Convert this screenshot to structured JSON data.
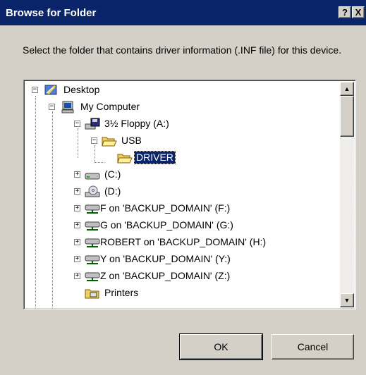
{
  "window": {
    "title": "Browse for Folder",
    "help_label": "?",
    "close_label": "X",
    "titlebar_color": "#0a246a"
  },
  "instruction": "Select the folder that contains driver information (.INF file) for this device.",
  "tree": {
    "items": [
      {
        "label": "Desktop",
        "icon": "desktop-icon",
        "expander": "−"
      },
      {
        "label": "My Computer",
        "icon": "computer-icon",
        "expander": "−"
      },
      {
        "label": "3½ Floppy (A:)",
        "icon": "floppy-drive-icon",
        "expander": "−"
      },
      {
        "label": "USB",
        "icon": "open-folder-icon",
        "expander": "−"
      },
      {
        "label": "DRIVER",
        "icon": "open-folder-icon",
        "expander": "",
        "selected": true
      },
      {
        "label": "(C:)",
        "icon": "hard-drive-icon",
        "expander": "+"
      },
      {
        "label": "(D:)",
        "icon": "cd-drive-icon",
        "expander": "+"
      },
      {
        "label": "F on 'BACKUP_DOMAIN' (F:)",
        "icon": "network-drive-icon",
        "expander": "+"
      },
      {
        "label": "G on 'BACKUP_DOMAIN' (G:)",
        "icon": "network-drive-icon",
        "expander": "+"
      },
      {
        "label": "ROBERT on 'BACKUP_DOMAIN' (H:)",
        "icon": "network-drive-icon",
        "expander": "+"
      },
      {
        "label": "Y on 'BACKUP_DOMAIN' (Y:)",
        "icon": "network-drive-icon",
        "expander": "+"
      },
      {
        "label": "Z on 'BACKUP_DOMAIN' (Z:)",
        "icon": "network-drive-icon",
        "expander": "+"
      },
      {
        "label": "Printers",
        "icon": "printers-folder-icon",
        "expander": ""
      }
    ]
  },
  "scrollbar": {
    "up_glyph": "▲",
    "down_glyph": "▼"
  },
  "buttons": {
    "ok_label": "OK",
    "cancel_label": "Cancel"
  }
}
